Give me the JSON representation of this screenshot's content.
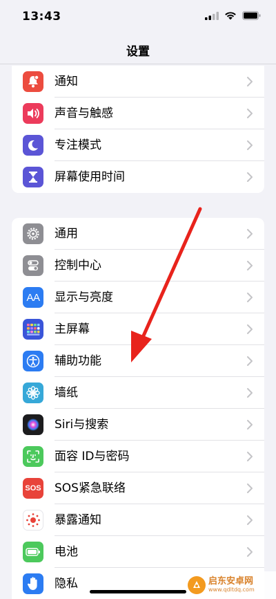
{
  "status": {
    "time": "13:43"
  },
  "nav": {
    "title": "设置"
  },
  "colors": {
    "accent_arrow": "#e8231c",
    "chevron": "#c4c4c7",
    "separator": "#e1e1e5"
  },
  "group1": [
    {
      "label": "通知",
      "icon": "bell-icon",
      "color": "#ec4c3f"
    },
    {
      "label": "声音与触感",
      "icon": "speaker-icon",
      "color": "#ec3b5b"
    },
    {
      "label": "专注模式",
      "icon": "moon-icon",
      "color": "#5b55d6"
    },
    {
      "label": "屏幕使用时间",
      "icon": "hourglass-icon",
      "color": "#5b55d6"
    }
  ],
  "group2": [
    {
      "label": "通用",
      "icon": "gear-icon",
      "color": "#8e8e93"
    },
    {
      "label": "控制中心",
      "icon": "toggles-icon",
      "color": "#8e8e93"
    },
    {
      "label": "显示与亮度",
      "icon": "text-size-icon",
      "color": "#2c7cf2"
    },
    {
      "label": "主屏幕",
      "icon": "grid-icon",
      "color": "#3a55d9"
    },
    {
      "label": "辅助功能",
      "icon": "accessibility-icon",
      "color": "#2c7cf2"
    },
    {
      "label": "墙纸",
      "icon": "flower-icon",
      "color": "#36a8d8"
    },
    {
      "label": "Siri与搜索",
      "icon": "siri-icon",
      "color": "#222222"
    },
    {
      "label": "面容 ID与密码",
      "icon": "face-id-icon",
      "color": "#4cc95c"
    },
    {
      "label": "SOS紧急联络",
      "icon": "sos-icon",
      "color": "#e8433a"
    },
    {
      "label": "暴露通知",
      "icon": "exposure-icon",
      "color": "#ffffff"
    },
    {
      "label": "电池",
      "icon": "battery-icon",
      "color": "#4cc95c"
    },
    {
      "label": "隐私",
      "icon": "hand-icon",
      "color": "#2c7cf2"
    }
  ],
  "watermark": {
    "title": "启东安卓网",
    "url": "www.qdltdq.com"
  }
}
